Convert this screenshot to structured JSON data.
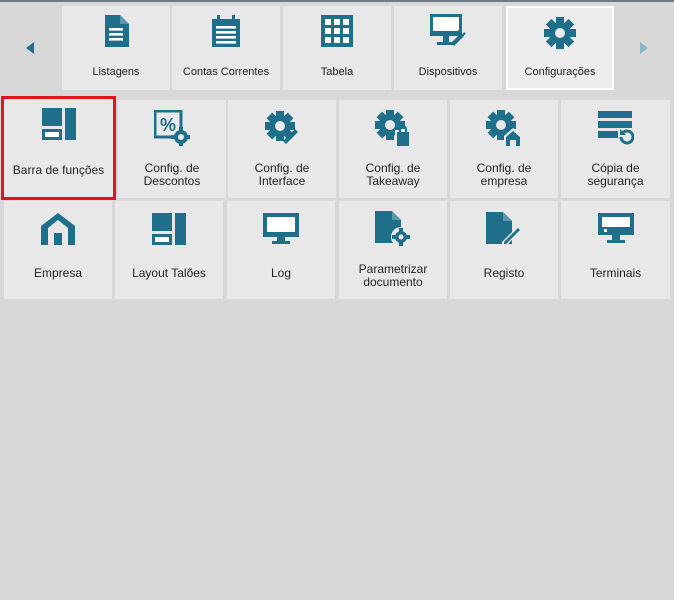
{
  "tabs": [
    {
      "label": "Listagens",
      "icon": "document-list-icon"
    },
    {
      "label": "Contas Correntes",
      "icon": "clipboard-icon"
    },
    {
      "label": "Tabela",
      "icon": "table-grid-icon"
    },
    {
      "label": "Dispositivos",
      "icon": "monitor-plug-icon"
    },
    {
      "label": "Configurações",
      "icon": "gear-icon",
      "active": true
    }
  ],
  "tiles": [
    {
      "label": "Barra de funções",
      "icon": "function-bar-icon",
      "selected": true
    },
    {
      "label": "Config. de\nDescontos",
      "icon": "percent-gear-icon"
    },
    {
      "label": "Config. de\nInterface",
      "icon": "gear-brush-icon"
    },
    {
      "label": "Config. de\nTakeaway",
      "icon": "gear-bag-icon"
    },
    {
      "label": "Config. de\nempresa",
      "icon": "gear-house-icon"
    },
    {
      "label": "Cópia de\nsegurança",
      "icon": "backup-icon"
    },
    {
      "label": "Empresa",
      "icon": "house-icon"
    },
    {
      "label": "Layout Talões",
      "icon": "layout-icon"
    },
    {
      "label": "Log",
      "icon": "monitor-icon"
    },
    {
      "label": "Parametrizar\ndocumento",
      "icon": "document-gear-icon"
    },
    {
      "label": "Registo",
      "icon": "document-edit-icon"
    },
    {
      "label": "Terminais",
      "icon": "terminal-icon"
    }
  ],
  "colors": {
    "icon": "#1f6f8b",
    "arrow_disabled": "#87b8c8",
    "selected_border": "#e3151c",
    "background": "#d8d8d8",
    "tile": "#e8e8e8"
  }
}
